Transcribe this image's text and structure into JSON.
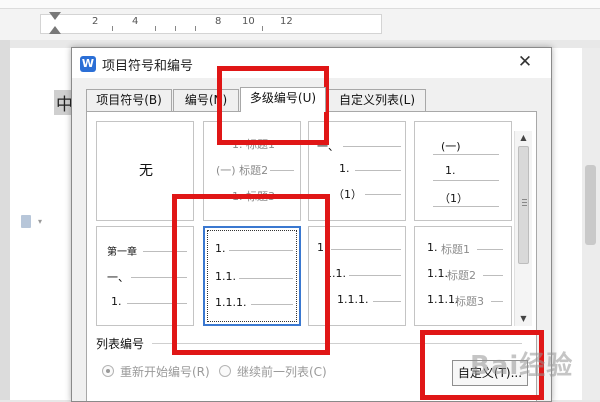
{
  "ruler": {
    "numbers": [
      "2",
      "4",
      "8",
      "10",
      "12"
    ]
  },
  "document": {
    "visible_char": "中"
  },
  "dialog": {
    "title": "项目符号和编号",
    "app_icon_letter": "W",
    "close_glyph": "✕",
    "tabs": [
      {
        "label": "项目符号(B)",
        "active": false
      },
      {
        "label": "编号(N)",
        "active": false
      },
      {
        "label": "多级编号(U)",
        "active": true
      },
      {
        "label": "自定义列表(L)",
        "active": false
      }
    ],
    "cells": {
      "none": {
        "label": "无"
      },
      "c2": {
        "l1": "1. 标题1",
        "l2": "(一) 标题2",
        "l3": "1. 标题3"
      },
      "c3": {
        "l1": "一、",
        "l2": "1.",
        "l3": "（1）"
      },
      "c4": {
        "l1": "(一)",
        "l2": "1.",
        "l3": "（1）"
      },
      "c5": {
        "l1": "第一章",
        "l2": "一、",
        "l3": "1."
      },
      "c6": {
        "l1": "1.",
        "l2": "1.1.",
        "l3": "1.1.1."
      },
      "c7": {
        "l1": "1.",
        "l2": "1.1.",
        "l3": "1.1.1."
      },
      "c8": {
        "l1_num": "1.",
        "l1_txt": "标题1",
        "l2_num": "1.1.",
        "l2_txt": "标题2",
        "l3_num": "1.1.1.",
        "l3_txt": "标题3"
      }
    },
    "list_numbering": {
      "label": "列表编号",
      "options": [
        {
          "label": "重新开始编号(R)",
          "checked": true
        },
        {
          "label": "继续前一列表(C)",
          "checked": false
        }
      ]
    },
    "custom_button": "自定义(T)..."
  },
  "watermark": "Bai经验",
  "colors": {
    "highlight": "#e01616",
    "selection": "#3a78d0",
    "app_icon": "#2b6fd6"
  }
}
